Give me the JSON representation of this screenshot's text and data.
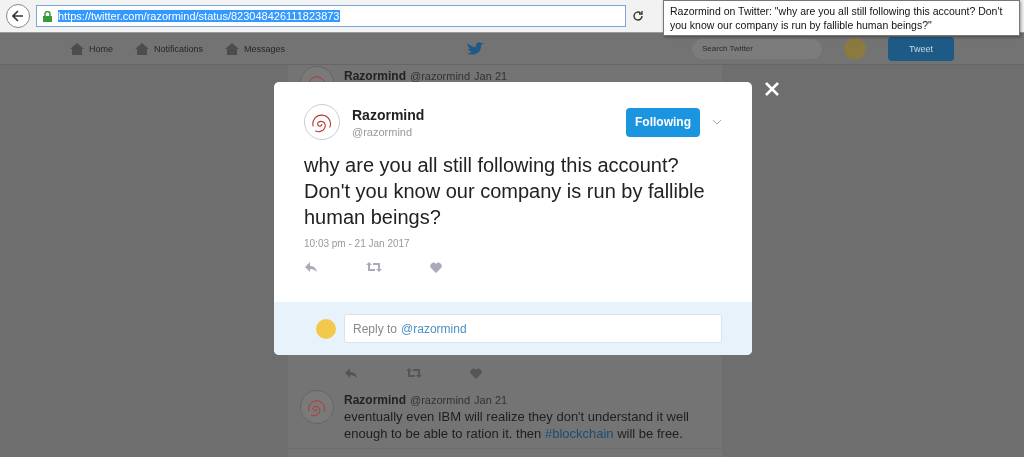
{
  "browser": {
    "url": "https://twitter.com/razormind/status/823048426111823873",
    "tooltip": "Razormind on Twitter: \"why are you all still following this account? Don't you know our company is run by fallible human beings?\""
  },
  "nav": {
    "items": [
      "Home",
      "Notifications",
      "Messages"
    ],
    "search_placeholder": "Search Twitter",
    "tweet_button": "Tweet"
  },
  "background_tweets": [
    {
      "name": "Razormind",
      "handle": "@razormind",
      "date": "Jan 21"
    },
    {
      "name": "Razormind",
      "handle": "@razormind",
      "date": "Jan 21",
      "text": "eventually even IBM will realize they don't understand it well enough to be able to ration it. then ",
      "hashtag": "#blockchain",
      "text_after": " will be free."
    }
  ],
  "modal": {
    "name": "Razormind",
    "handle": "@razormind",
    "follow_button": "Following",
    "text": "why are you all still following this account? Don't you know our company is run by fallible human beings?",
    "timestamp": "10:03 pm - 21 Jan 2017",
    "reply_placeholder": "Reply to",
    "reply_mention": "@razormind"
  }
}
